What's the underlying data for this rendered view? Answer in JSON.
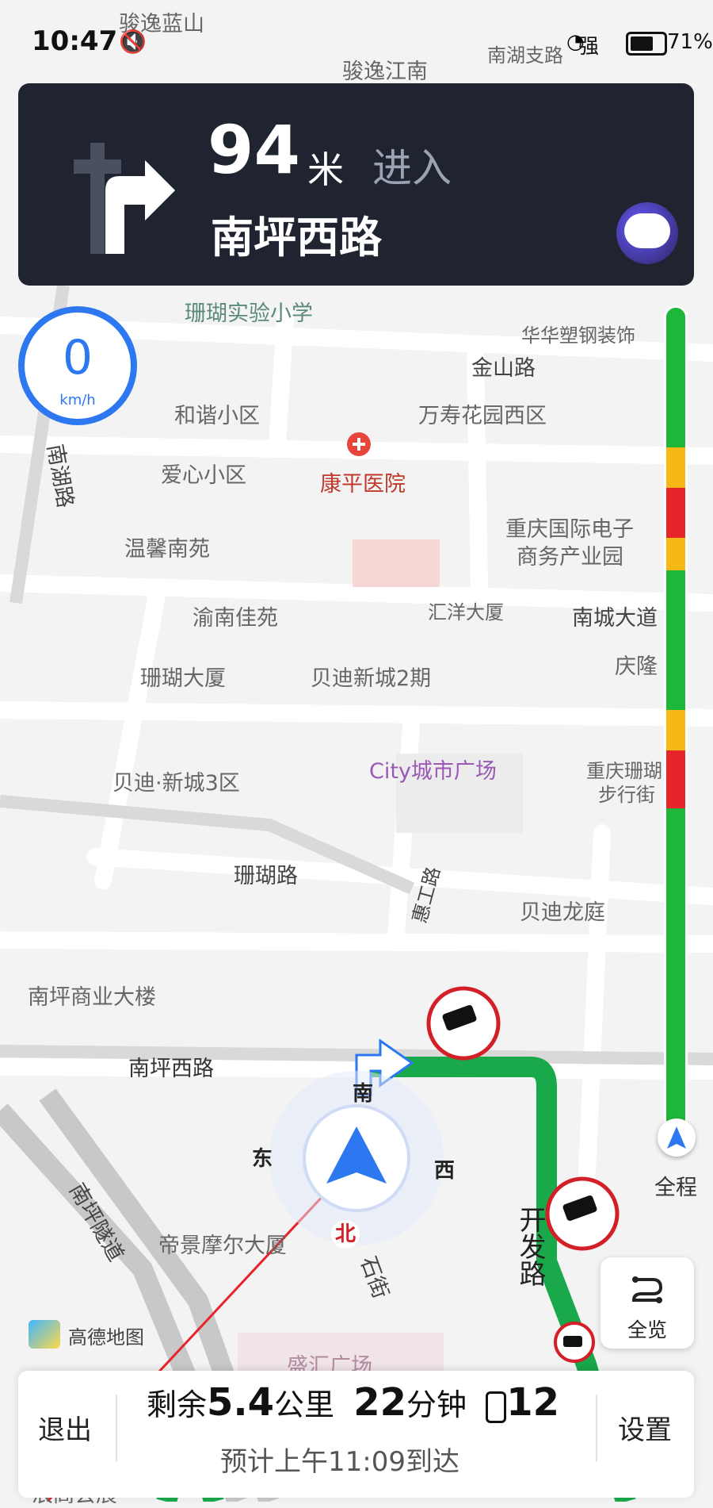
{
  "status_bar": {
    "time": "10:47",
    "signal": "强",
    "battery": "71%",
    "battery_level": 0.71
  },
  "navigation": {
    "distance": "94",
    "distance_unit": "米",
    "action": "进入",
    "street": "南坪西路"
  },
  "speedometer": {
    "value": "0",
    "unit": "km/h"
  },
  "map_labels": {
    "l1": "骏逸蓝山",
    "l2": "骏逸江南",
    "l3": "南湖支路",
    "l4": "珊瑚实验小学",
    "l5": "华华塑钢装饰",
    "l6": "金山路",
    "l7": "和谐小区",
    "l8": "万寿花园西区",
    "l9": "爱心小区",
    "l10": "康平医院",
    "l11": "南湖路",
    "l12": "温馨南苑",
    "l13": "重庆国际电子",
    "l14": "商务产业园",
    "l15": "渝南佳苑",
    "l16": "汇洋大厦",
    "l17": "南城大道",
    "l18": "珊瑚大厦",
    "l19": "贝迪新城2期",
    "l20": "庆隆",
    "l21": "City城市广场",
    "l22": "贝迪·新城3区",
    "l23": "重庆珊瑚",
    "l24": "步行街",
    "l25": "珊瑚路",
    "l26": "贝迪龙庭",
    "l27": "惠工路",
    "l28": "南坪商业大楼",
    "l29": "南坪西路",
    "l30": "帝景摩尔大厦",
    "l31": "南坪隧道",
    "l32": "开发路",
    "l33": "石街",
    "l34": "盛汇广场",
    "l35": "浪高会展"
  },
  "compass": {
    "south": "南",
    "east": "东",
    "west": "西",
    "north": "北"
  },
  "sidebar": {
    "full_trip": "全程",
    "overview": "全览"
  },
  "brand": "高德地图",
  "traffic_bar": [
    {
      "status": "smooth",
      "from": 0.0,
      "to": 0.17
    },
    {
      "status": "slow",
      "from": 0.17,
      "to": 0.22
    },
    {
      "status": "congested",
      "from": 0.22,
      "to": 0.28
    },
    {
      "status": "slow",
      "from": 0.28,
      "to": 0.32
    },
    {
      "status": "smooth",
      "from": 0.32,
      "to": 0.49
    },
    {
      "status": "slow",
      "from": 0.49,
      "to": 0.54
    },
    {
      "status": "congested",
      "from": 0.54,
      "to": 0.61
    },
    {
      "status": "smooth",
      "from": 0.61,
      "to": 1.0
    }
  ],
  "colors": {
    "smooth": "#1db73a",
    "slow": "#f5b816",
    "congested": "#e8242b",
    "route": "#19a84a",
    "accent": "#2d78f0"
  },
  "bottom_bar": {
    "exit": "退出",
    "remain_prefix": "剩余",
    "distance": "5.4",
    "distance_unit": "公里",
    "time": "22",
    "time_unit": "分钟",
    "traffic_lights": "12",
    "eta": "预计上午11:09到达",
    "settings": "设置"
  }
}
